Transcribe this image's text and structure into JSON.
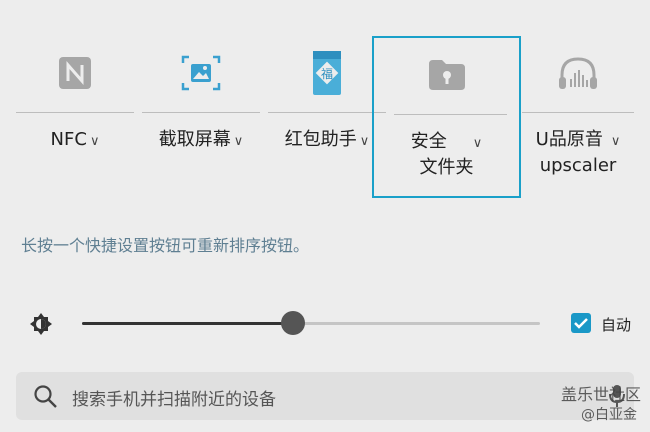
{
  "tiles": [
    {
      "label": "NFC",
      "icon": "nfc-icon"
    },
    {
      "label": "截取屏幕",
      "icon": "screenshot-icon"
    },
    {
      "label": "红包助手",
      "icon": "red-envelope-icon"
    },
    {
      "label_line1": "安全",
      "label_line2": "文件夹",
      "icon": "secure-folder-icon",
      "selected": true
    },
    {
      "label_line1": "U品原音",
      "label_line2": "upscaler",
      "icon": "headphones-icon"
    }
  ],
  "hint": "长按一个快捷设置按钮可重新排序按钮。",
  "brightness": {
    "level": 0.46,
    "auto_label": "自动",
    "auto_checked": true
  },
  "search": {
    "placeholder": "搜索手机并扫描附近的设备"
  },
  "watermark": {
    "line1": "盖乐世社区",
    "line2": "@白亚金"
  },
  "colors": {
    "accent": "#1aa0c9",
    "icon_gray": "#9e9e9e",
    "red_envelope": "#4aaed8"
  }
}
